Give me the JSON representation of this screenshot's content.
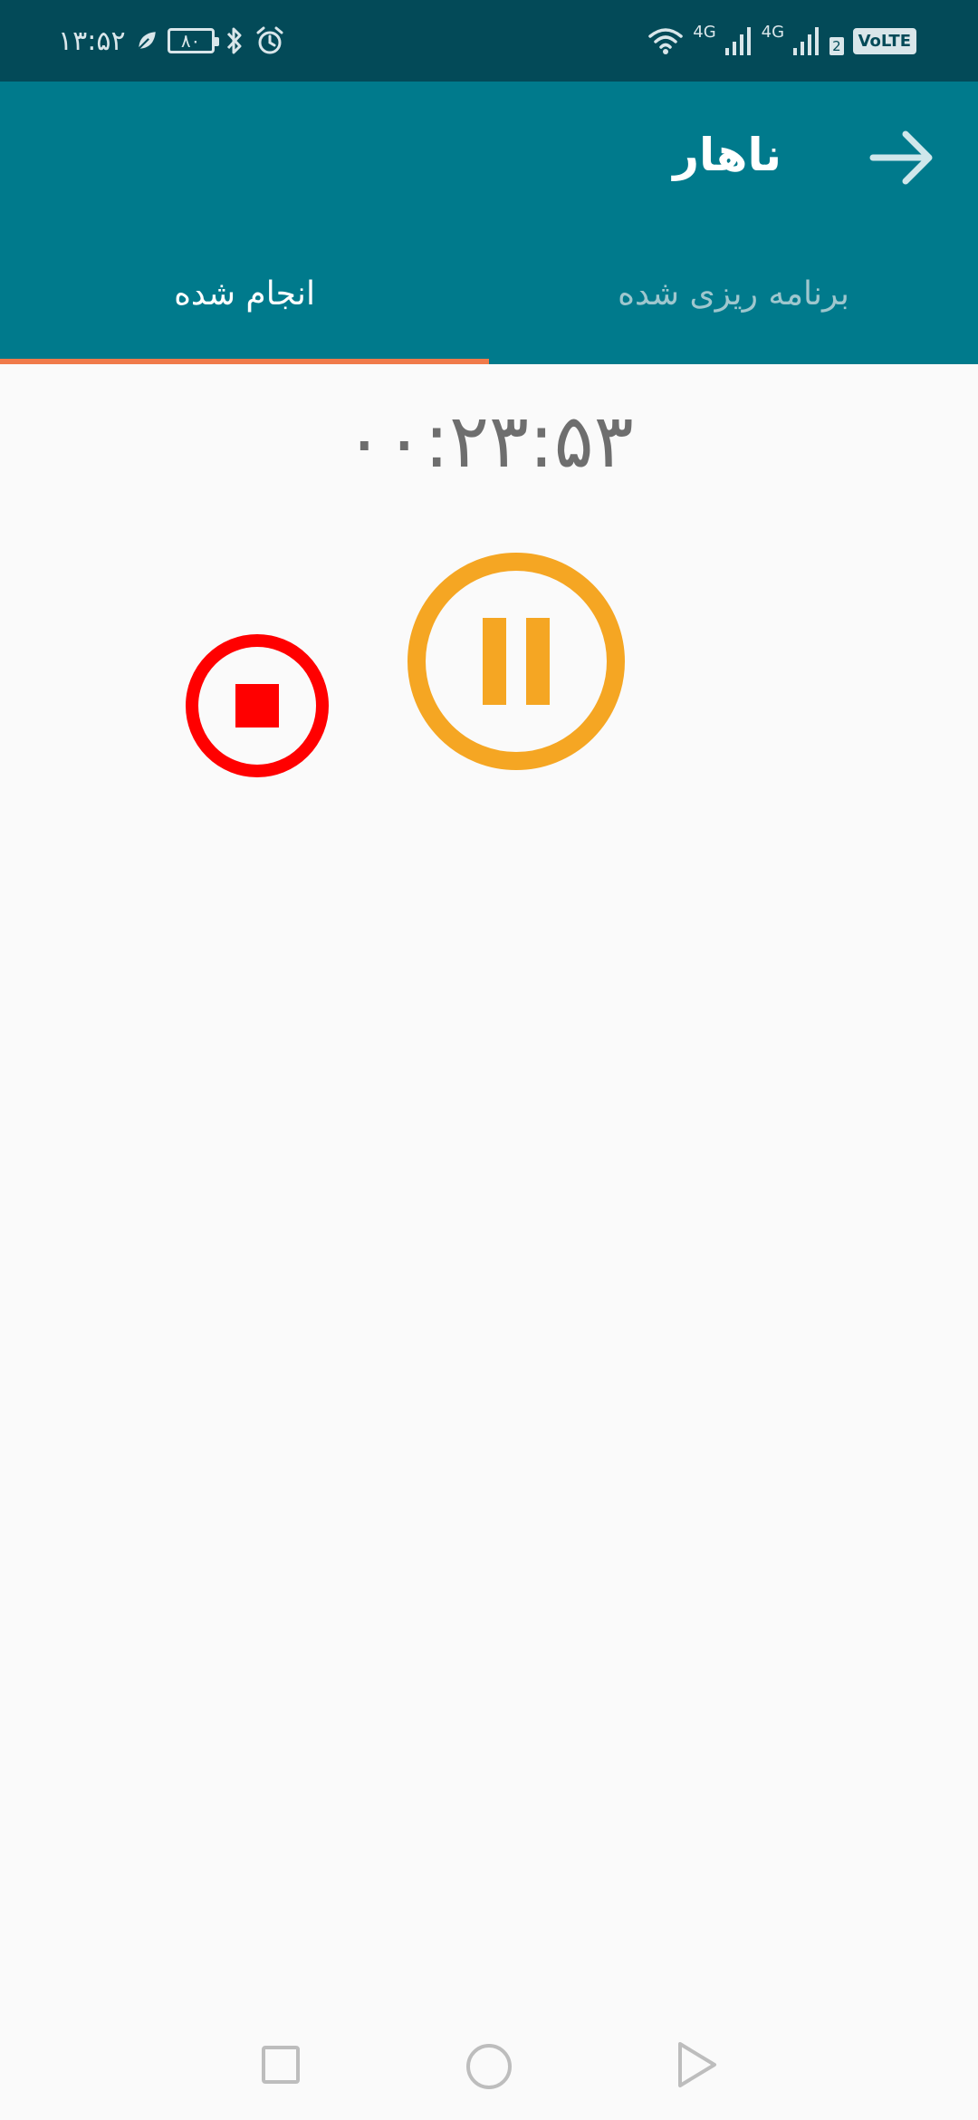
{
  "status_bar": {
    "time": "۱۳:۵۲",
    "battery_level": "۸۰",
    "network_1": "4G",
    "network_2": "4G",
    "sim_number": "2",
    "volte": "VoLTE"
  },
  "app_bar": {
    "title": "ناهار"
  },
  "tabs": [
    {
      "label": "برنامه ریزی شده",
      "selected": false
    },
    {
      "label": "انجام شده",
      "selected": true
    }
  ],
  "timer": {
    "display": "۰۰:۲۳:۵۳"
  },
  "colors": {
    "status_bar": "#034a58",
    "app_bar": "#007a8c",
    "tab_indicator": "#f07a4a",
    "pause": "#f5a623",
    "stop": "#ff0000",
    "background": "#fafafa"
  },
  "icons": {
    "back": "arrow-right-icon",
    "pause": "pause-circle-icon",
    "stop": "stop-circle-icon",
    "nav_recent": "square-icon",
    "nav_home": "circle-icon",
    "nav_back": "triangle-icon"
  }
}
